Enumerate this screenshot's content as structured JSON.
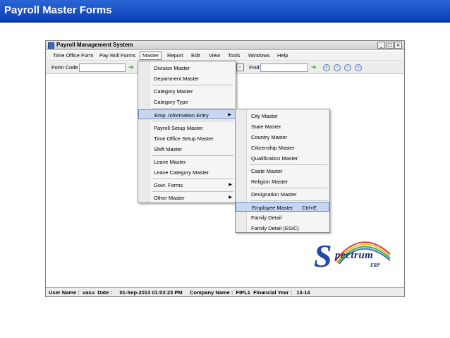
{
  "slide": {
    "title": "Payroll Master Forms"
  },
  "window": {
    "title": "Payroll Management System",
    "controls": [
      "_",
      "□",
      "×"
    ]
  },
  "menubar": {
    "items": [
      "Time Office Form",
      "Pay Roll Forms",
      "Master",
      "Report",
      "Edit",
      "View",
      "Tools",
      "Windows",
      "Help"
    ]
  },
  "toolbar": {
    "form_code_label": "Form Code",
    "form_code_value": "",
    "find_label": "Find",
    "find_value": ""
  },
  "master_menu": {
    "items": [
      {
        "label": "Division Master"
      },
      {
        "label": "Department Master"
      },
      {
        "label": "Category Master"
      },
      {
        "label": "Category Type"
      },
      {
        "label": "Emp. Information Entry",
        "submenu": true
      },
      {
        "label": "Payroll Setup Master"
      },
      {
        "label": "Time Office Setup Master"
      },
      {
        "label": "Shift Master"
      },
      {
        "label": "Leave Master"
      },
      {
        "label": "Leave Category Master"
      },
      {
        "label": "Govt. Forms",
        "submenu": true
      },
      {
        "label": "Other Master",
        "submenu": true
      }
    ]
  },
  "emp_info_menu": {
    "items": [
      {
        "label": "City Master"
      },
      {
        "label": "State Master"
      },
      {
        "label": "Country Master"
      },
      {
        "label": "Citizenship Master"
      },
      {
        "label": "Qualification Master"
      },
      {
        "label": "Caste Master"
      },
      {
        "label": "Religion Master"
      },
      {
        "label": "Designation Master"
      },
      {
        "label": "Employee Master",
        "shortcut": "Ctrl+E"
      },
      {
        "label": "Family Detail"
      },
      {
        "label": "Family Detail (ESIC)"
      }
    ]
  },
  "statusbar": {
    "text": "User Name :  vasu  Date :     01-Sep-2013 01:03:23 PM     Company Name :  FIPL1  Financial Year :   13-14"
  },
  "logo": {
    "letter": "S",
    "word": "pectrum",
    "suffix": "ERP"
  }
}
